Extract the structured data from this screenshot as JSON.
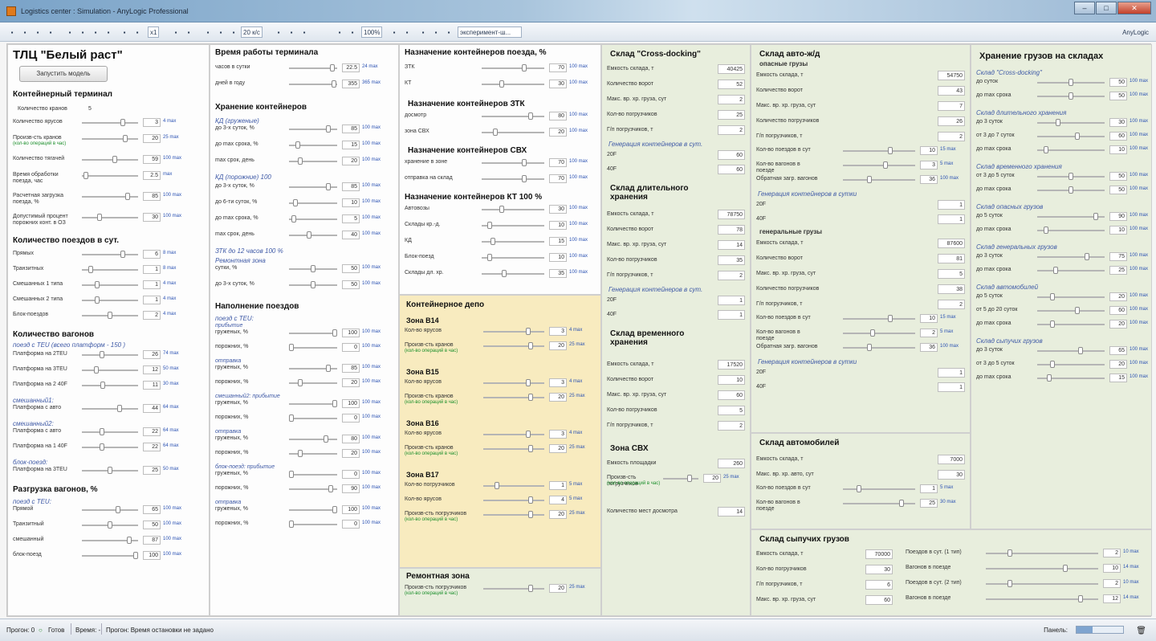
{
  "window": {
    "title": "Logistics center : Simulation - AnyLogic Professional"
  },
  "toolbar": {
    "speed": "x1",
    "fps": "20 к/с",
    "zoom": "100%",
    "experiment": "эксперимент-ш...",
    "brand": "AnyLogic"
  },
  "left": {
    "title": "ТЛЦ \"Белый раст\"",
    "run_button": "Запустить модель",
    "terminal": {
      "header": "Контейнерный терминал",
      "cranes_label": "Количество кранов",
      "cranes_value": "5",
      "rows": [
        {
          "label": "Количество ярусов",
          "value": "3",
          "unit": "4 max"
        },
        {
          "label": "Произв-сть кранов",
          "note": "(кол-во операций в час)",
          "value": "20",
          "unit": "25 max"
        },
        {
          "label": "Количество тягачей",
          "value": "59",
          "unit": "100 max"
        },
        {
          "label": "Время обработки поезда, час",
          "value": "2.5",
          "unit": "max"
        },
        {
          "label": "Расчетная загрузка поезда, %",
          "value": "85",
          "unit": "100 max"
        },
        {
          "label": "Допустимый процент порожних конт. в ОЗ",
          "value": "30",
          "unit": "100 max"
        }
      ]
    },
    "trains": {
      "header": "Количество поездов в сут.",
      "rows": [
        {
          "label": "Прямых",
          "value": "6",
          "unit": "8 max"
        },
        {
          "label": "Транзитных",
          "value": "1",
          "unit": "8 max"
        },
        {
          "label": "Смешанных 1 типа",
          "value": "1",
          "unit": "4 max"
        },
        {
          "label": "Смешанных 2 типа",
          "value": "1",
          "unit": "4 max"
        },
        {
          "label": "Блок-поездов",
          "value": "2",
          "unit": "4 max"
        }
      ]
    },
    "wagons": {
      "header": "Количество вагонов",
      "sub1": "поезд с TEU",
      "sub1_note": "(всего платформ - 150 )",
      "rows1": [
        {
          "label": "Платформа на 2TEU",
          "value": "26",
          "unit": "74 max"
        },
        {
          "label": "Платформа на 3TEU",
          "value": "12",
          "unit": "50 max"
        },
        {
          "label": "Платформа на 2 40F",
          "value": "11",
          "unit": "30 max"
        }
      ],
      "sub2": "смешанный1:",
      "rows2": [
        {
          "label": "Платформа с авто",
          "value": "44",
          "unit": "64 max"
        }
      ],
      "sub3": "смешанный2:",
      "rows3": [
        {
          "label": "Платформа с авто",
          "value": "22",
          "unit": "64 max"
        },
        {
          "label": "Платформа на 1 40F",
          "value": "22",
          "unit": "64 max"
        }
      ],
      "sub4": "блок-поезд:",
      "rows4": [
        {
          "label": "Платформа на 3TEU",
          "value": "25",
          "unit": "50 max"
        }
      ]
    },
    "unloading": {
      "header": "Разгрузка вагонов, %",
      "sub": "поезд с TEU:",
      "rows": [
        {
          "label": "Прямой",
          "value": "65",
          "unit": "100 max"
        },
        {
          "label": "Транзитный",
          "value": "50",
          "unit": "100 max"
        },
        {
          "label": "смешанный",
          "value": "87",
          "unit": "100 max"
        },
        {
          "label": "блок-поезд",
          "value": "100",
          "unit": "100 max"
        }
      ]
    }
  },
  "col2": {
    "work": {
      "header": "Время работы терминала",
      "rows": [
        {
          "label": "часов в сутки",
          "value": "22.5",
          "unit": "24 max"
        },
        {
          "label": "дней в году",
          "value": "355",
          "unit": "365 max"
        }
      ]
    },
    "storage": {
      "header": "Хранение контейнеров",
      "sub1": "КД (груженые)",
      "rows1": [
        {
          "label": "до 3-х суток, %",
          "value": "85",
          "unit": "100 max"
        },
        {
          "label": "до max срока, %",
          "value": "15",
          "unit": "100 max"
        },
        {
          "label": "max срок, день",
          "value": "20",
          "unit": "100 max"
        }
      ],
      "sub2": "КД (порожние)",
      "sub2_value": "100",
      "rows2": [
        {
          "label": "до 3-х суток, %",
          "value": "85",
          "unit": "100 max"
        },
        {
          "label": "до 6-ти суток, %",
          "value": "10",
          "unit": "100 max"
        },
        {
          "label": "до max срока, %",
          "value": "5",
          "unit": "100 max"
        },
        {
          "label": "max срок, день",
          "value": "40",
          "unit": "100 max"
        }
      ],
      "stk_text": "ЗТК до 12 часов 100 %",
      "sub3": "Ремонтная зона",
      "rows3": [
        {
          "label": "сутки, %",
          "value": "50",
          "unit": "100 max"
        },
        {
          "label": "до 3-х суток, %",
          "value": "50",
          "unit": "100 max"
        }
      ]
    },
    "filling": {
      "header": "Наполнение поездов",
      "sub": "поезд с TEU:",
      "groups": [
        {
          "title": "прибытие",
          "rows": [
            {
              "label": "груженых, %",
              "value": "100",
              "unit": "100 max"
            },
            {
              "label": "порожних, %",
              "value": "0",
              "unit": "100 max"
            }
          ]
        },
        {
          "title": "отправка",
          "rows": [
            {
              "label": "груженых, %",
              "value": "85",
              "unit": "100 max"
            },
            {
              "label": "порожних, %",
              "value": "20",
              "unit": "100 max"
            }
          ]
        },
        {
          "title": "смешанный2: прибытие",
          "rows": [
            {
              "label": "груженых, %",
              "value": "100",
              "unit": "100 max"
            },
            {
              "label": "порожних, %",
              "value": "0",
              "unit": "100 max"
            }
          ]
        },
        {
          "title": "отправка",
          "rows": [
            {
              "label": "груженых, %",
              "value": "80",
              "unit": "100 max"
            },
            {
              "label": "порожних, %",
              "value": "20",
              "unit": "100 max"
            }
          ]
        },
        {
          "title": "блок-поезд: прибытие",
          "rows": [
            {
              "label": "груженых, %",
              "value": "0",
              "unit": "100 max"
            },
            {
              "label": "порожних, %",
              "value": "90",
              "unit": "100 max"
            }
          ]
        },
        {
          "title": "отправка",
          "rows": [
            {
              "label": "груженых, %",
              "value": "100",
              "unit": "100 max"
            },
            {
              "label": "порожних, %",
              "value": "0",
              "unit": "100 max"
            }
          ]
        }
      ]
    }
  },
  "col3": {
    "purpose": {
      "header": "Назначение контейнеров поезда, %",
      "rows": [
        {
          "label": "ЗТК",
          "value": "70",
          "unit": "100 max"
        },
        {
          "label": "КТ",
          "value": "30",
          "unit": "100 max"
        }
      ]
    },
    "ztk": {
      "header": "Назначение контейнеров ЗТК",
      "rows": [
        {
          "label": "досмотр",
          "value": "80",
          "unit": "100 max"
        },
        {
          "label": "зона СВХ",
          "value": "20",
          "unit": "100 max"
        }
      ]
    },
    "svh": {
      "header": "Назначение контейнеров СВХ",
      "rows": [
        {
          "label": "хранение в зоне",
          "value": "70",
          "unit": "100 max"
        },
        {
          "label": "отправка на склад",
          "value": "70",
          "unit": "100 max"
        }
      ]
    },
    "kt": {
      "header": "Назначение контейнеров КТ",
      "header_value": "100",
      "header_unit": "%",
      "rows": [
        {
          "label": "Автовозы",
          "value": "30",
          "unit": "100 max"
        },
        {
          "label": "Склады кр.-д.",
          "value": "10",
          "unit": "100 max"
        },
        {
          "label": "КД",
          "value": "15",
          "unit": "100 max"
        },
        {
          "label": "Блок-поезд",
          "value": "10",
          "unit": "100 max"
        },
        {
          "label": "Склады дл. хр.",
          "value": "35",
          "unit": "100 max"
        }
      ]
    },
    "depot": {
      "header": "Контейнерное депо",
      "zones": [
        {
          "title": "Зона В14",
          "rows": [
            {
              "label": "Кол-во ярусов",
              "value": "3",
              "unit": "4 max"
            },
            {
              "label": "Произв-сть кранов",
              "note": "(кол-во операций в час)",
              "value": "20",
              "unit": "25 max"
            }
          ]
        },
        {
          "title": "Зона В15",
          "rows": [
            {
              "label": "Кол-во ярусов",
              "value": "3",
              "unit": "4 max"
            },
            {
              "label": "Произв-сть кранов",
              "note": "(кол-во операций в час)",
              "value": "20",
              "unit": "25 max"
            }
          ]
        },
        {
          "title": "Зона В16",
          "rows": [
            {
              "label": "Кол-во ярусов",
              "value": "3",
              "unit": "4 max"
            },
            {
              "label": "Произв-сть кранов",
              "note": "(кол-во операций в час)",
              "value": "20",
              "unit": "25 max"
            }
          ]
        },
        {
          "title": "Зона В17",
          "rows": [
            {
              "label": "Кол-во погрузчиков",
              "value": "1",
              "unit": "5 max"
            },
            {
              "label": "Кол-во ярусов",
              "value": "4",
              "unit": "5 max"
            },
            {
              "label": "Произв-сть погрузчиков",
              "note": "(кол-во операций в час)",
              "value": "20",
              "unit": "25 max"
            }
          ]
        }
      ]
    },
    "repair": {
      "header": "Ремонтная зона",
      "label": "Произв-сть погрузчиков",
      "note": "(кол-во операций в час)",
      "value": "20",
      "unit": "25 max"
    }
  },
  "col4": {
    "crossdock": {
      "header": "Склад \"Cross-docking\"",
      "fields": [
        {
          "label": "Емкость склада, т",
          "value": "40425"
        },
        {
          "label": "Количество ворот",
          "value": "52"
        },
        {
          "label": "Макс. вр. хр. груза, сут",
          "value": "2"
        },
        {
          "label": "Кол-во погрузчиков",
          "value": "25"
        },
        {
          "label": "Г/п погрузчиков, т",
          "value": "2"
        }
      ],
      "gen": "Генерация контейнеров в сут.",
      "gen_fields": [
        {
          "label": "20F",
          "value": "60"
        },
        {
          "label": "40F",
          "value": "60"
        }
      ]
    },
    "longterm": {
      "header": "Склад длительного хранения",
      "fields": [
        {
          "label": "Емкость склада, т",
          "value": "78750"
        },
        {
          "label": "Количество ворот",
          "value": "78"
        },
        {
          "label": "Макс. вр. хр. груза, сут",
          "value": "14"
        },
        {
          "label": "Кол-во погрузчиков",
          "value": "35"
        },
        {
          "label": "Г/п погрузчиков, т",
          "value": "2"
        }
      ],
      "gen": "Генерация контейнеров в сут.",
      "gen_fields": [
        {
          "label": "20F",
          "value": "1"
        },
        {
          "label": "40F",
          "value": "1"
        }
      ]
    },
    "temporary": {
      "header": "Склад временного хранения",
      "fields": [
        {
          "label": "Емкость склада, т",
          "value": "17520"
        },
        {
          "label": "Количество ворот",
          "value": "10"
        },
        {
          "label": "Макс. вр. хр. груза, сут",
          "value": "60"
        },
        {
          "label": "Кол-во погрузчиков",
          "value": "5"
        },
        {
          "label": "Г/п погрузчиков, т",
          "value": "2"
        }
      ]
    },
    "svh": {
      "header": "Зона СВХ",
      "area_label": "Емкость площадки",
      "area_value": "260",
      "row_label": "Произв-сть погрузчиков",
      "row_note": "(кол-во операций в час)",
      "row_value": "20",
      "row_unit": "25 max",
      "places_label": "Количество мест досмотра",
      "places_value": "14"
    }
  },
  "col5": {
    "auto": {
      "header": "Склад авто-ж/д",
      "dangerous": "опасные грузы",
      "fields1": [
        {
          "label": "Емкость склада, т",
          "value": "54750"
        },
        {
          "label": "Количество ворот",
          "value": "43"
        },
        {
          "label": "Макс. вр. хр. груза, сут",
          "value": "7"
        },
        {
          "label": "Количество погрузчиков",
          "value": "26"
        },
        {
          "label": "Г/п погрузчиков, т",
          "value": "2"
        }
      ],
      "rows1": [
        {
          "label": "Кол-во поездов в сут",
          "value": "10",
          "unit": "15 max"
        },
        {
          "label": "Кол-во вагонов в поезде",
          "value": "3",
          "unit": "5 max"
        },
        {
          "label": "Обратная загр. вагонов",
          "value": "36",
          "unit": "100 max"
        }
      ],
      "gen": "Генерация контейнеров в сутки",
      "gen_fields1": [
        {
          "label": "20F",
          "value": "1"
        },
        {
          "label": "40F",
          "value": "1"
        }
      ],
      "general": "генеральные грузы",
      "fields2": [
        {
          "label": "Емкость склада, т",
          "value": "87600"
        },
        {
          "label": "Количество ворот",
          "value": "81"
        },
        {
          "label": "Макс. вр. хр. груза, сут",
          "value": "5"
        },
        {
          "label": "Количество погрузчиков",
          "value": "38"
        },
        {
          "label": "Г/п погрузчиков, т",
          "value": "2"
        }
      ],
      "rows2": [
        {
          "label": "Кол-во поездов в сут",
          "value": "10",
          "unit": "15 max"
        },
        {
          "label": "Кол-во вагонов в поезде",
          "value": "2",
          "unit": "5 max"
        },
        {
          "label": "Обратная загр. вагонов",
          "value": "36",
          "unit": "100 max"
        }
      ],
      "gen_fields2": [
        {
          "label": "20F",
          "value": "1"
        },
        {
          "label": "40F",
          "value": "1"
        }
      ]
    },
    "cars": {
      "header": "Склад автомобилей",
      "fields": [
        {
          "label": "Емкость склада, т",
          "value": "7000"
        },
        {
          "label": "Макс. вр. хр. авто, сут",
          "value": "30"
        }
      ],
      "rows": [
        {
          "label": "Кол-во поездов в сут",
          "value": "1",
          "unit": "5 max"
        },
        {
          "label": "Кол-во вагонов в поезде",
          "value": "25",
          "unit": "30 max"
        }
      ]
    }
  },
  "col6": {
    "header": "Хранение грузов на складах",
    "groups": [
      {
        "title": "Склад \"Cross-docking\"",
        "rows": [
          {
            "label": "до суток",
            "value": "50",
            "unit": "100 max"
          },
          {
            "label": "до max срока",
            "value": "50",
            "unit": "100 max"
          }
        ]
      },
      {
        "title": "Склад длительного хранения",
        "rows": [
          {
            "label": "до 3 суток",
            "value": "30",
            "unit": "100 max"
          },
          {
            "label": "от 3 до 7 суток",
            "value": "60",
            "unit": "100 max"
          },
          {
            "label": "до max срока",
            "value": "10",
            "unit": "100 max"
          }
        ]
      },
      {
        "title": "Склад временного хранения",
        "rows": [
          {
            "label": "от 3 до 5 суток",
            "value": "50",
            "unit": "100 max"
          },
          {
            "label": "до max срока",
            "value": "50",
            "unit": "100 max"
          }
        ]
      },
      {
        "title": "Склад опасных грузов",
        "rows": [
          {
            "label": "до 5 суток",
            "value": "90",
            "unit": "100 max"
          },
          {
            "label": "до max срока",
            "value": "10",
            "unit": "100 max"
          }
        ]
      },
      {
        "title": "Склад генеральных грузов",
        "rows": [
          {
            "label": "до 3 суток",
            "value": "75",
            "unit": "100 max"
          },
          {
            "label": "до max срока",
            "value": "25",
            "unit": "100 max"
          }
        ]
      },
      {
        "title": "Склад автомобилей",
        "rows": [
          {
            "label": "до 5 суток",
            "value": "20",
            "unit": "100 max"
          },
          {
            "label": "от 5 до 20 суток",
            "value": "60",
            "unit": "100 max"
          },
          {
            "label": "до max срока",
            "value": "20",
            "unit": "100 max"
          }
        ]
      },
      {
        "title": "Склад сыпучих грузов",
        "rows": [
          {
            "label": "до 3 суток",
            "value": "65",
            "unit": "100 max"
          },
          {
            "label": "от 3 до 5 суток",
            "value": "20",
            "unit": "100 max"
          },
          {
            "label": "до max срока",
            "value": "15",
            "unit": "100 max"
          }
        ]
      }
    ]
  },
  "bulk": {
    "header": "Склад сыпучих грузов",
    "fields": [
      {
        "label": "Емкость склада, т",
        "value": "70000"
      },
      {
        "label": "Кол-во погрузчиков",
        "value": "30"
      },
      {
        "label": "Г/п погрузчиков, т",
        "value": "6"
      },
      {
        "label": "Макс. вр. хр. груза, сут",
        "value": "60"
      }
    ],
    "rows": [
      {
        "label": "Поездов в сут. (1 тип)",
        "value": "2",
        "unit": "10 max"
      },
      {
        "label": "Вагонов в поезде",
        "value": "10",
        "unit": "14 max"
      },
      {
        "label": "Поездов в сут. (2 тип)",
        "value": "2",
        "unit": "10 max"
      },
      {
        "label": "Вагонов в поезде",
        "value": "12",
        "unit": "14 max"
      }
    ]
  },
  "status": {
    "run": "Прогон: 0",
    "ready": "Готов",
    "time": "Время: -",
    "stop": "Прогон: Время остановки не задано",
    "panel": "Панель:",
    "progress": 0.35
  }
}
